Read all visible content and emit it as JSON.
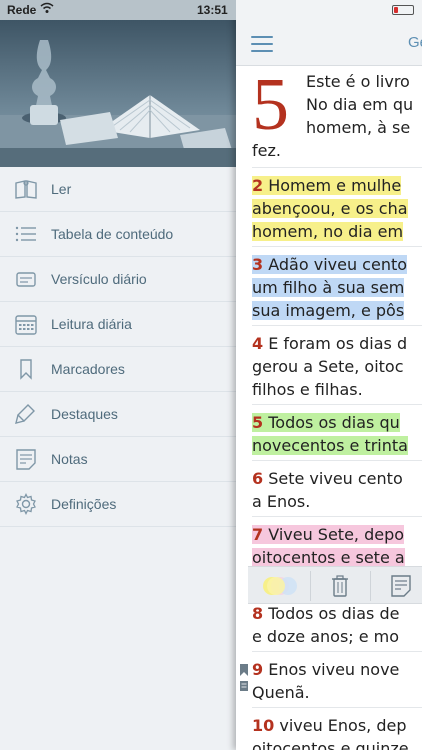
{
  "status_bar": {
    "carrier": "Rede",
    "time": "13:51"
  },
  "sidebar": {
    "items": [
      {
        "label": "Ler",
        "icon": "book-open-icon"
      },
      {
        "label": "Tabela de conteúdo",
        "icon": "list-icon"
      },
      {
        "label": "Versículo diário",
        "icon": "cards-icon"
      },
      {
        "label": "Leitura diária",
        "icon": "calendar-icon"
      },
      {
        "label": "Marcadores",
        "icon": "bookmark-icon"
      },
      {
        "label": "Destaques",
        "icon": "highlighter-icon"
      },
      {
        "label": "Notas",
        "icon": "note-icon"
      },
      {
        "label": "Definições",
        "icon": "gear-icon"
      }
    ]
  },
  "reader": {
    "book_title": "Gé",
    "chapter": "5",
    "intro_lines": [
      "Este é o livro",
      "No dia em qu",
      "homem, à se"
    ],
    "intro_last": "fez.",
    "verses": [
      {
        "num": "2",
        "lines": [
          " Homem e mulhe",
          "abençoou, e os cha",
          "homem, no dia em"
        ],
        "highlight": "yellow"
      },
      {
        "num": "3",
        "lines": [
          " Adão viveu cento",
          "um filho à sua sem",
          "sua imagem, e pôs"
        ],
        "highlight": "blue"
      },
      {
        "num": "4",
        "lines": [
          " E foram os dias d",
          "gerou a Sete, oitoc",
          "filhos e filhas."
        ],
        "highlight": "none"
      },
      {
        "num": "5",
        "lines": [
          " Todos os dias qu",
          "novecentos e trinta"
        ],
        "highlight": "green"
      },
      {
        "num": "6",
        "lines": [
          " Sete viveu cento",
          "a Enos."
        ],
        "highlight": "none"
      },
      {
        "num": "7",
        "lines": [
          " Viveu Sete, depo",
          "oitocentos e sete a"
        ],
        "highlight": "pink"
      },
      {
        "num": "8",
        "lines": [
          " Todos os dias de",
          "e doze anos; e mo"
        ],
        "highlight": "none"
      },
      {
        "num": "9",
        "lines": [
          " Enos viveu nove",
          "Quenã."
        ],
        "highlight": "none"
      },
      {
        "num": "10",
        "lines": [
          " viveu Enos, dep",
          "oitocentos e quinze"
        ],
        "highlight": "none"
      }
    ]
  },
  "colors": {
    "accent": "#5d8fb3",
    "verse_number": "#b4321f",
    "highlight_yellow": "#f7f08a",
    "highlight_blue": "#bfd8f5",
    "highlight_green": "#bff0a0",
    "highlight_pink": "#f6c7dd"
  }
}
